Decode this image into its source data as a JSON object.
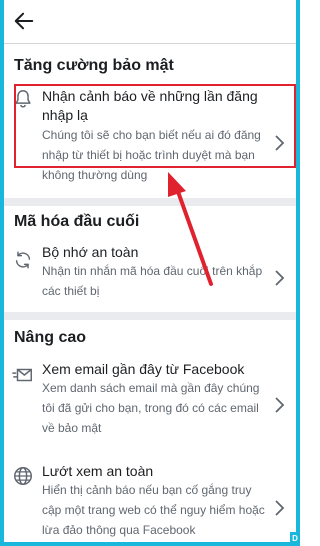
{
  "sections": [
    {
      "title": "Tăng cường bảo mật",
      "items": [
        {
          "icon": "bell-icon",
          "title": "Nhận cảnh báo về những lần đăng nhập lạ",
          "description": "Chúng tôi sẽ cho bạn biết nếu ai đó đăng nhập từ thiết bị hoặc trình duyệt mà bạn không thường dùng"
        }
      ]
    },
    {
      "title": "Mã hóa đầu cuối",
      "items": [
        {
          "icon": "sync-icon",
          "title": "Bộ nhớ an toàn",
          "description": "Nhận tin nhắn mã hóa đầu cuối trên khắp các thiết bị"
        }
      ]
    },
    {
      "title": "Nâng cao",
      "items": [
        {
          "icon": "email-icon",
          "title": "Xem email gần đây từ Facebook",
          "description": "Xem danh sách email mà gần đây chúng tôi đã gửi cho bạn, trong đó có các email về bảo mật"
        },
        {
          "icon": "globe-icon",
          "title": "Lướt xem an toàn",
          "description": "Hiển thị cảnh báo nếu bạn cố gắng truy cập một trang web có thể nguy hiểm hoặc lừa đảo thông qua Facebook"
        }
      ]
    }
  ],
  "colors": {
    "highlight": "#e0212e",
    "frame": "#19b7dc"
  }
}
